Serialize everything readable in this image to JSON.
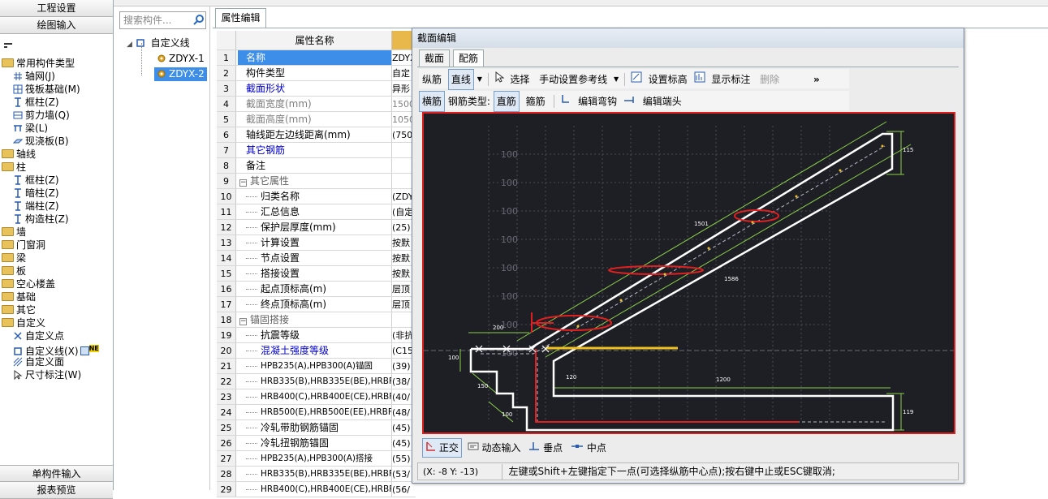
{
  "left_panel": {
    "header_top": "工程设置",
    "header_second": "绘图输入",
    "footer_first": "单构件输入",
    "footer_second": "报表预览",
    "tree": [
      {
        "label": "常用构件类型",
        "level": 0,
        "icon": "folder-icon"
      },
      {
        "label": "轴网(J)",
        "level": 1,
        "icon": "grid-icon"
      },
      {
        "label": "筏板基础(M)",
        "level": 1,
        "icon": "raft-icon"
      },
      {
        "label": "框柱(Z)",
        "level": 1,
        "icon": "column-icon"
      },
      {
        "label": "剪力墙(Q)",
        "level": 1,
        "icon": "wall-icon"
      },
      {
        "label": "梁(L)",
        "level": 1,
        "icon": "beam-icon"
      },
      {
        "label": "现浇板(B)",
        "level": 1,
        "icon": "slab-icon"
      },
      {
        "label": "轴线",
        "level": 0,
        "icon": "folder-icon"
      },
      {
        "label": "柱",
        "level": 0,
        "icon": "folder-icon"
      },
      {
        "label": "框柱(Z)",
        "level": 1,
        "icon": "column-icon"
      },
      {
        "label": "暗柱(Z)",
        "level": 1,
        "icon": "column-icon"
      },
      {
        "label": "端柱(Z)",
        "level": 1,
        "icon": "column-icon"
      },
      {
        "label": "构造柱(Z)",
        "level": 1,
        "icon": "column-icon"
      },
      {
        "label": "墙",
        "level": 0,
        "icon": "folder-icon"
      },
      {
        "label": "门窗洞",
        "level": 0,
        "icon": "folder-icon"
      },
      {
        "label": "梁",
        "level": 0,
        "icon": "folder-icon"
      },
      {
        "label": "板",
        "level": 0,
        "icon": "folder-icon"
      },
      {
        "label": "空心楼盖",
        "level": 0,
        "icon": "folder-icon"
      },
      {
        "label": "基础",
        "level": 0,
        "icon": "folder-icon"
      },
      {
        "label": "其它",
        "level": 0,
        "icon": "folder-icon"
      },
      {
        "label": "自定义",
        "level": 0,
        "icon": "folder-icon"
      },
      {
        "label": "自定义点",
        "level": 1,
        "icon": "custom-point-icon"
      },
      {
        "label": "自定义线(X)",
        "level": 1,
        "icon": "custom-line-icon",
        "badge": "NE"
      },
      {
        "label": "自定义面",
        "level": 1,
        "icon": "custom-area-icon"
      },
      {
        "label": "尺寸标注(W)",
        "level": 1,
        "icon": "dimension-icon"
      }
    ]
  },
  "component_panel": {
    "search_placeholder": "搜索构件...",
    "root": "自定义线",
    "items": [
      "ZDYX-1",
      "ZDYX-2"
    ],
    "selected": "ZDYX-2"
  },
  "property_panel": {
    "tab": "属性编辑",
    "col_header": "属性名称",
    "rows": [
      {
        "n": "1",
        "name": "名称",
        "value": "ZDYX",
        "style": "blue",
        "selected": true
      },
      {
        "n": "2",
        "name": "构件类型",
        "value": "自定",
        "style": "normal"
      },
      {
        "n": "3",
        "name": "截面形状",
        "value": "异形",
        "style": "blue"
      },
      {
        "n": "4",
        "name": "截面宽度(mm)",
        "value": "1500",
        "style": "gray"
      },
      {
        "n": "5",
        "name": "截面高度(mm)",
        "value": "1050",
        "style": "gray"
      },
      {
        "n": "6",
        "name": "轴线距左边线距离(mm)",
        "value": "(750",
        "style": "normal"
      },
      {
        "n": "7",
        "name": "其它钢筋",
        "value": "",
        "style": "blue"
      },
      {
        "n": "8",
        "name": "备注",
        "value": "",
        "style": "normal"
      },
      {
        "n": "9",
        "name": "其它属性",
        "value": "",
        "style": "group"
      },
      {
        "n": "10",
        "name": "归类名称",
        "value": "(ZDY",
        "style": "child"
      },
      {
        "n": "11",
        "name": "汇总信息",
        "value": "(自定",
        "style": "child"
      },
      {
        "n": "12",
        "name": "保护层厚度(mm)",
        "value": "(25)",
        "style": "child"
      },
      {
        "n": "13",
        "name": "计算设置",
        "value": "按默",
        "style": "child"
      },
      {
        "n": "14",
        "name": "节点设置",
        "value": "按默",
        "style": "child"
      },
      {
        "n": "15",
        "name": "搭接设置",
        "value": "按默",
        "style": "child"
      },
      {
        "n": "16",
        "name": "起点顶标高(m)",
        "value": "层顶",
        "style": "child"
      },
      {
        "n": "17",
        "name": "终点顶标高(m)",
        "value": "层顶",
        "style": "child"
      },
      {
        "n": "18",
        "name": "锚固搭接",
        "value": "",
        "style": "group"
      },
      {
        "n": "19",
        "name": "抗震等级",
        "value": "(非抗",
        "style": "child"
      },
      {
        "n": "20",
        "name": "混凝土强度等级",
        "value": "(C15",
        "style": "childblue"
      },
      {
        "n": "21",
        "name": "HPB235(A),HPB300(A)锚固",
        "value": "(39)",
        "style": "child"
      },
      {
        "n": "22",
        "name": "HRB335(B),HRB335E(BE),HRBF",
        "value": "(38/",
        "style": "child"
      },
      {
        "n": "23",
        "name": "HRB400(C),HRB400E(CE),HRBF",
        "value": "(40/",
        "style": "child"
      },
      {
        "n": "24",
        "name": "HRB500(E),HRB500E(EE),HRBF",
        "value": "(48/",
        "style": "child"
      },
      {
        "n": "25",
        "name": "冷轧带肋钢筋锚固",
        "value": "(45)",
        "style": "child"
      },
      {
        "n": "26",
        "name": "冷轧扭钢筋锚固",
        "value": "(45)",
        "style": "child"
      },
      {
        "n": "27",
        "name": "HPB235(A),HPB300(A)搭接",
        "value": "(55)",
        "style": "child"
      },
      {
        "n": "28",
        "name": "HRB335(B),HRB335E(BE),HRBF",
        "value": "(53/",
        "style": "child"
      },
      {
        "n": "29",
        "name": "HRB400(C),HRB400E(CE),HRBF",
        "value": "(56/",
        "style": "child"
      }
    ]
  },
  "dialog": {
    "title": "截面编辑",
    "tabs": [
      "截面",
      "配筋"
    ],
    "active_tab": "配筋",
    "toolbar1": {
      "longitudinal": "纵筋",
      "line": "直线",
      "select": "选择",
      "manual_ref": "手动设置参考线",
      "set_elev": "设置标高",
      "show_label": "显示标注",
      "delete": "删除",
      "more": "»"
    },
    "toolbar2": {
      "transverse": "横筋",
      "rebar_type_label": "钢筋类型:",
      "straight": "直筋",
      "stirrup": "箍筋",
      "edit_hook": "编辑弯钩",
      "edit_end": "编辑端头"
    },
    "canvas_labels": {
      "ticks": [
        "100",
        "100",
        "100",
        "100",
        "100",
        "100",
        "100",
        "100"
      ],
      "dim_115": "115",
      "dim_1501": "1501",
      "dim_1586": "1586",
      "dim_200": "200",
      "dim_100_left": "100",
      "dim_120": "120",
      "dim_1200": "1200",
      "dim_150": "150",
      "dim_100_bottom": "100",
      "dim_119": "119"
    },
    "bottom_toolbar": {
      "ortho": "正交",
      "dynamic_input": "动态输入",
      "perpendicular": "垂点",
      "midpoint": "中点"
    },
    "status": {
      "coords": "(X: -8 Y: -13)",
      "message": "左键或Shift+左键指定下一点(可选择纵筋中心点);按右键中止或ESC键取消;"
    }
  },
  "colors": {
    "accent": "#3399ff",
    "selected_row": "#3c8ee8",
    "canvas_bg": "#1e1e25",
    "highlight_red": "#e02020",
    "blue_text": "#0000cc"
  }
}
